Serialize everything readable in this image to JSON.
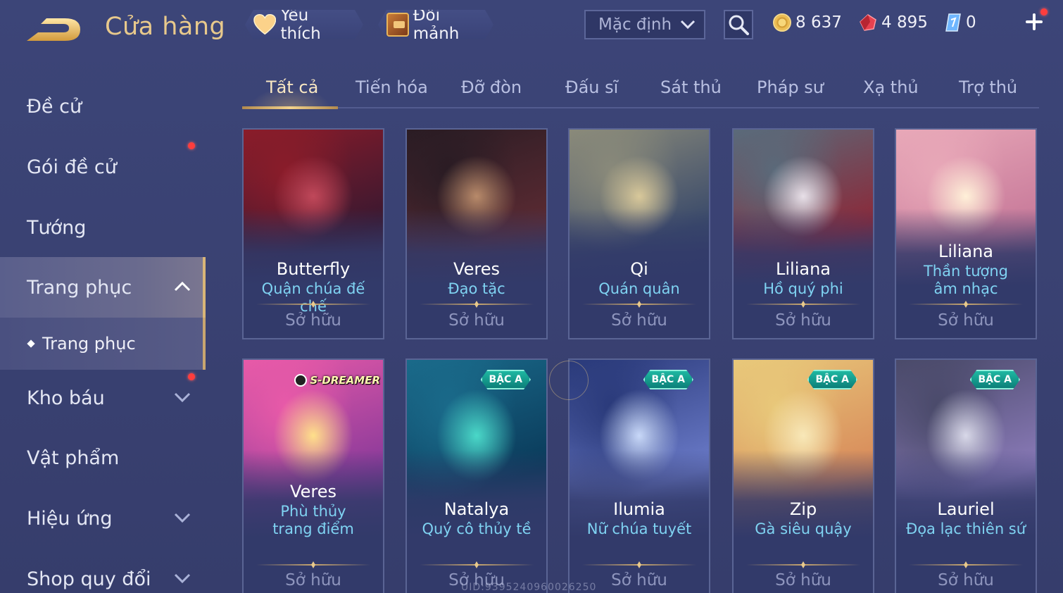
{
  "header": {
    "title": "Cửa hàng",
    "favorites_label": "Yêu thích",
    "exchange_label": "Đổi mảnh",
    "sort_value": "Mặc định"
  },
  "currencies": {
    "gold": "8 637",
    "ruby": "4 895",
    "voucher": "0"
  },
  "sidebar": {
    "items": [
      {
        "label": "Đề cử"
      },
      {
        "label": "Gói đề cử"
      },
      {
        "label": "Tướng"
      },
      {
        "label": "Trang phục"
      },
      {
        "label": "Kho báu"
      },
      {
        "label": "Vật phẩm"
      },
      {
        "label": "Hiệu ứng"
      },
      {
        "label": "Shop quy đổi"
      }
    ],
    "sub_item": "Trang phục"
  },
  "tabs": [
    "Tất cả",
    "Tiến hóa",
    "Đỡ đòn",
    "Đấu sĩ",
    "Sát thủ",
    "Pháp sư",
    "Xạ thủ",
    "Trợ thủ"
  ],
  "owned_label": "Sở hữu",
  "cards": [
    {
      "hero": "Butterfly",
      "skin": "Quận chúa đế chế",
      "colors": [
        "#8a1c2a",
        "#3a1830",
        "#c0485a"
      ]
    },
    {
      "hero": "Veres",
      "skin": "Đạo tặc",
      "colors": [
        "#2a1c24",
        "#5a2a32",
        "#b88a6a"
      ]
    },
    {
      "hero": "Qi",
      "skin": "Quán quân",
      "colors": [
        "#8a8a7a",
        "#3a4a6a",
        "#d8c89a"
      ]
    },
    {
      "hero": "Liliana",
      "skin": "Hồ quý phi",
      "colors": [
        "#5a6a7a",
        "#8a2a3a",
        "#e8e0e8"
      ]
    },
    {
      "hero": "Liliana",
      "skin": "Thần tượng âm nhạc",
      "colors": [
        "#e8a8b8",
        "#c87a9a",
        "#fff0d8"
      ]
    },
    {
      "hero": "Veres",
      "skin": "Phù thủy trang điểm",
      "colors": [
        "#e85aa8",
        "#8a3a9a",
        "#ffe08a"
      ],
      "brand": "S-DREAMER"
    },
    {
      "hero": "Natalya",
      "skin": "Quý cô thủy tề",
      "colors": [
        "#1a6a8a",
        "#0a3a5a",
        "#4ad8c8"
      ],
      "badge": "BẬC A"
    },
    {
      "hero": "Ilumia",
      "skin": "Nữ chúa tuyết",
      "colors": [
        "#2a3a7a",
        "#6a7ac8",
        "#c8d8f8"
      ],
      "badge": "BẬC A"
    },
    {
      "hero": "Zip",
      "skin": "Gà siêu quậy",
      "colors": [
        "#e8c87a",
        "#d88a5a",
        "#f8e8b8"
      ],
      "badge": "BẬC A"
    },
    {
      "hero": "Lauriel",
      "skin": "Đọa lạc thiên sứ",
      "colors": [
        "#4a4a6a",
        "#8a7ab8",
        "#d8d8e8"
      ],
      "badge": "BẬC A"
    }
  ],
  "watermark": "UID:9395240960026250"
}
